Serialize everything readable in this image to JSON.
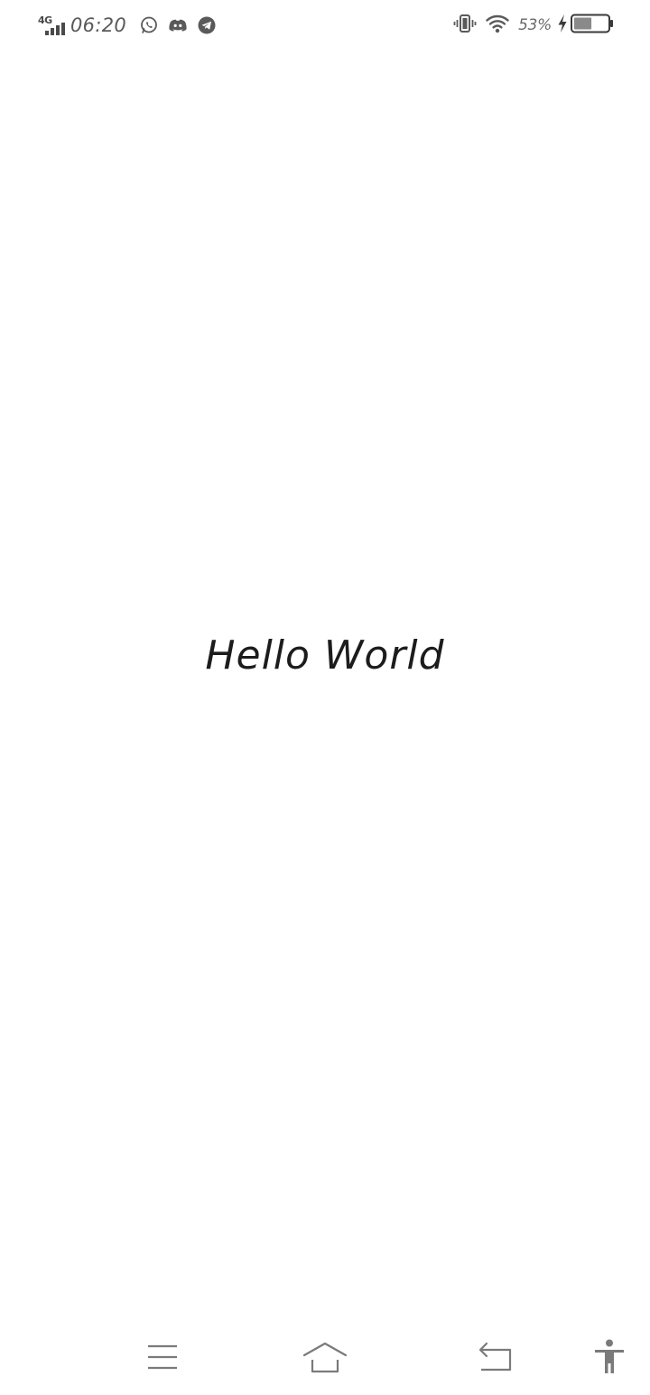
{
  "status_bar": {
    "network_type": "4G",
    "time": "06:20",
    "battery_percent": "53%",
    "battery_level": 0.53,
    "notification_icons": [
      "whatsapp-icon",
      "discord-icon",
      "telegram-icon"
    ],
    "system_icons": [
      "vibrate-icon",
      "wifi-icon",
      "charging-bolt-icon",
      "battery-icon"
    ]
  },
  "main": {
    "text": "Hello World"
  },
  "nav_bar": {
    "buttons": [
      "menu-icon",
      "home-icon",
      "back-icon",
      "accessibility-icon"
    ]
  },
  "colors": {
    "background": "#ffffff",
    "text": "#1c1c1c",
    "status_icon": "#5a5a5a",
    "nav_icon": "#7a7a7a"
  }
}
